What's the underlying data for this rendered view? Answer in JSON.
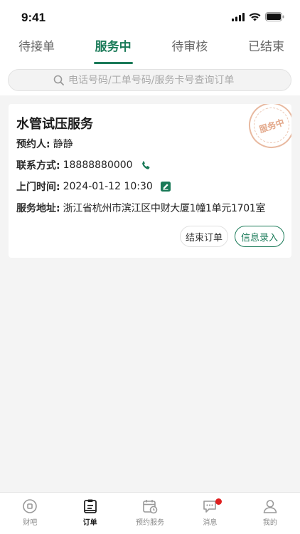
{
  "status_bar": {
    "time": "9:41"
  },
  "tabs": [
    {
      "label": "待接单"
    },
    {
      "label": "服务中"
    },
    {
      "label": "待审核"
    },
    {
      "label": "已结束"
    }
  ],
  "search": {
    "placeholder": "电话号码/工单号码/服务卡号查询订单"
  },
  "order": {
    "title": "水管试压服务",
    "stamp": "服务中",
    "booker_label": "预约人:",
    "booker": "静静",
    "contact_label": "联系方式:",
    "contact": "18888880000",
    "visit_label": "上门时间:",
    "visit_time": "2024-01-12 10:30",
    "address_label": "服务地址:",
    "address": "浙江省杭州市滨江区中财大厦1幢1单元1701室",
    "end_button": "结束订单",
    "info_button": "信息录入"
  },
  "bottom_nav": [
    {
      "label": "财吧",
      "icon": "circle-square-icon"
    },
    {
      "label": "订单",
      "icon": "order-list-icon"
    },
    {
      "label": "预约服务",
      "icon": "calendar-clock-icon"
    },
    {
      "label": "消息",
      "icon": "chat-bubble-icon"
    },
    {
      "label": "我的",
      "icon": "person-icon"
    }
  ],
  "colors": {
    "accent": "#1a7a58",
    "stamp": "#e8b9a0",
    "badge": "#e02020"
  }
}
